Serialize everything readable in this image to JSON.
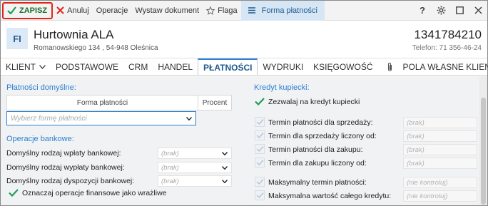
{
  "toolbar": {
    "save_label": "ZAPISZ",
    "cancel_label": "Anuluj",
    "operations_label": "Operacje",
    "issue_document_label": "Wystaw dokument",
    "flag_label": "Flaga",
    "payment_form_label": "Forma płatności"
  },
  "client": {
    "initials": "FI",
    "name": "Hurtownia ALA",
    "address": "Romanowskiego 134 , 54-948 Oleśnica",
    "code": "1341784210",
    "phone": "Telefon: 71 356-46-24"
  },
  "tabs": [
    {
      "label": "KLIENT"
    },
    {
      "label": "PODSTAWOWE"
    },
    {
      "label": "CRM"
    },
    {
      "label": "HANDEL"
    },
    {
      "label": "PŁATNOŚCI"
    },
    {
      "label": "WYDRUKI"
    },
    {
      "label": "KSIĘGOWOŚĆ"
    },
    {
      "label": "POLA WŁASNE KLIENTA"
    }
  ],
  "payments": {
    "section_title": "Płatności domyślne:",
    "col_form": "Forma płatności",
    "col_percent": "Procent",
    "select_placeholder": "Wybierz formę płatności"
  },
  "bank": {
    "section_title": "Operacje bankowe:",
    "rows": [
      {
        "label": "Domyślny rodzaj wpłaty bankowej:",
        "value": "(brak)"
      },
      {
        "label": "Domyślny rodzaj wypłaty bankowej:",
        "value": "(brak)"
      },
      {
        "label": "Domyślny rodzaj dyspozycji bankowej:",
        "value": "(brak)"
      }
    ],
    "sensitive_label": "Oznaczaj operacje finansowe jako wrażliwe"
  },
  "credit": {
    "section_title": "Kredyt kupiecki:",
    "allow_label": "Zezwalaj na kredyt kupiecki",
    "rows": [
      {
        "label": "Termin płatności dla sprzedaży:",
        "value": "(brak)"
      },
      {
        "label": "Termin dla sprzedaży liczony od:",
        "value": "(brak)"
      },
      {
        "label": "Termin płatności dla zakupu:",
        "value": "(brak)"
      },
      {
        "label": "Termin dla zakupu liczony od:",
        "value": "(brak)"
      },
      {
        "label": "Maksymalny termin płatności:",
        "value": "(nie kontroluj)"
      },
      {
        "label": "Maksymalna wartość całego kredytu:",
        "value": "(nie kontroluj)"
      }
    ]
  },
  "colors": {
    "accent": "#2c7fd1",
    "save_border": "#e1251b",
    "check_green": "#1f9d55"
  },
  "icons": [
    "check-icon",
    "close-icon",
    "flag-icon",
    "menu-icon",
    "help-icon",
    "gear-icon",
    "maximize-icon",
    "close-window-icon",
    "chevron-down-icon",
    "paperclip-icon"
  ]
}
